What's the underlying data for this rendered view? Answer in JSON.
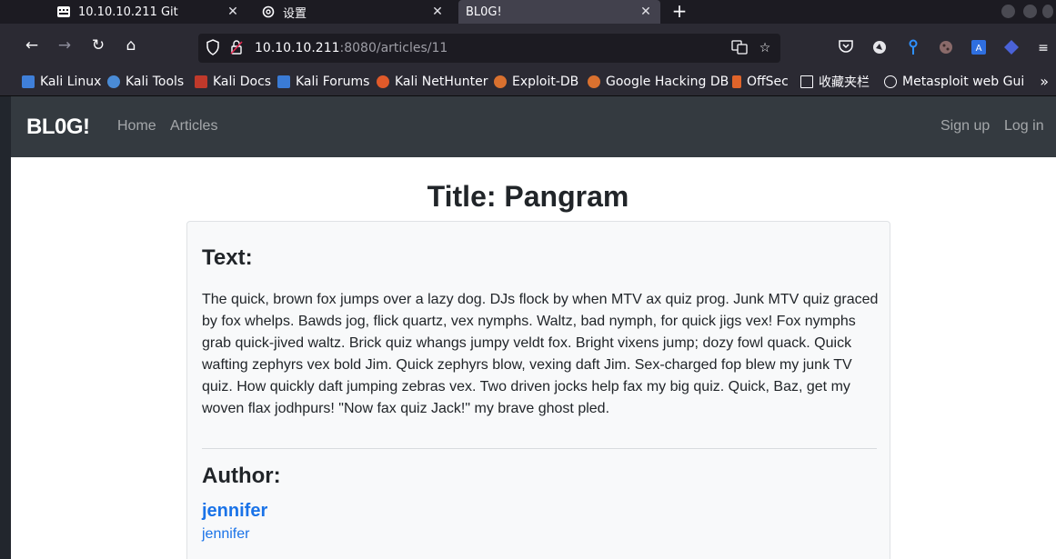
{
  "tabs": [
    {
      "title": "10.10.10.211 Git",
      "close": "✕"
    },
    {
      "title": "设置",
      "close": "✕"
    },
    {
      "title": "BL0G!",
      "close": "✕"
    }
  ],
  "newtab": "+",
  "url": {
    "host": "10.10.10.211",
    "path": ":8080/articles/11"
  },
  "bookmarks": [
    {
      "label": "Kali Linux",
      "color": "#3f7fd9"
    },
    {
      "label": "Kali Tools",
      "color": "#4a8bd6"
    },
    {
      "label": "Kali Docs",
      "color": "#c0392b"
    },
    {
      "label": "Kali Forums",
      "color": "#3a7bd5"
    },
    {
      "label": "Kali NetHunter",
      "color": "#e05a2a"
    },
    {
      "label": "Exploit-DB",
      "color": "#d9712f"
    },
    {
      "label": "Google Hacking DB",
      "color": "#d9712f"
    },
    {
      "label": "OffSec",
      "color": "#e0642a"
    },
    {
      "label": "收藏夹栏",
      "color": "#ffffff"
    },
    {
      "label": "Metasploit web Gui",
      "color": "#ffffff"
    }
  ],
  "bookmarks_more": "»",
  "site": {
    "brand": "BL0G!",
    "nav": {
      "home": "Home",
      "articles": "Articles",
      "signup": "Sign up",
      "login": "Log in"
    }
  },
  "article": {
    "title": "Title: Pangram",
    "text_heading": "Text:",
    "text": "The quick, brown fox jumps over a lazy dog. DJs flock by when MTV ax quiz prog. Junk MTV quiz graced by fox whelps. Bawds jog, flick quartz, vex nymphs. Waltz, bad nymph, for quick jigs vex! Fox nymphs grab quick-jived waltz. Brick quiz whangs jumpy veldt fox. Bright vixens jump; dozy fowl quack. Quick wafting zephyrs vex bold Jim. Quick zephyrs blow, vexing daft Jim. Sex-charged fop blew my junk TV quiz. How quickly daft jumping zebras vex. Two driven jocks help fax my big quiz. Quick, Baz, get my woven flax jodhpurs! \"Now fax quiz Jack!\" my brave ghost pled.",
    "author_heading": "Author:",
    "author_name": "jennifer",
    "author_link": "jennifer"
  }
}
